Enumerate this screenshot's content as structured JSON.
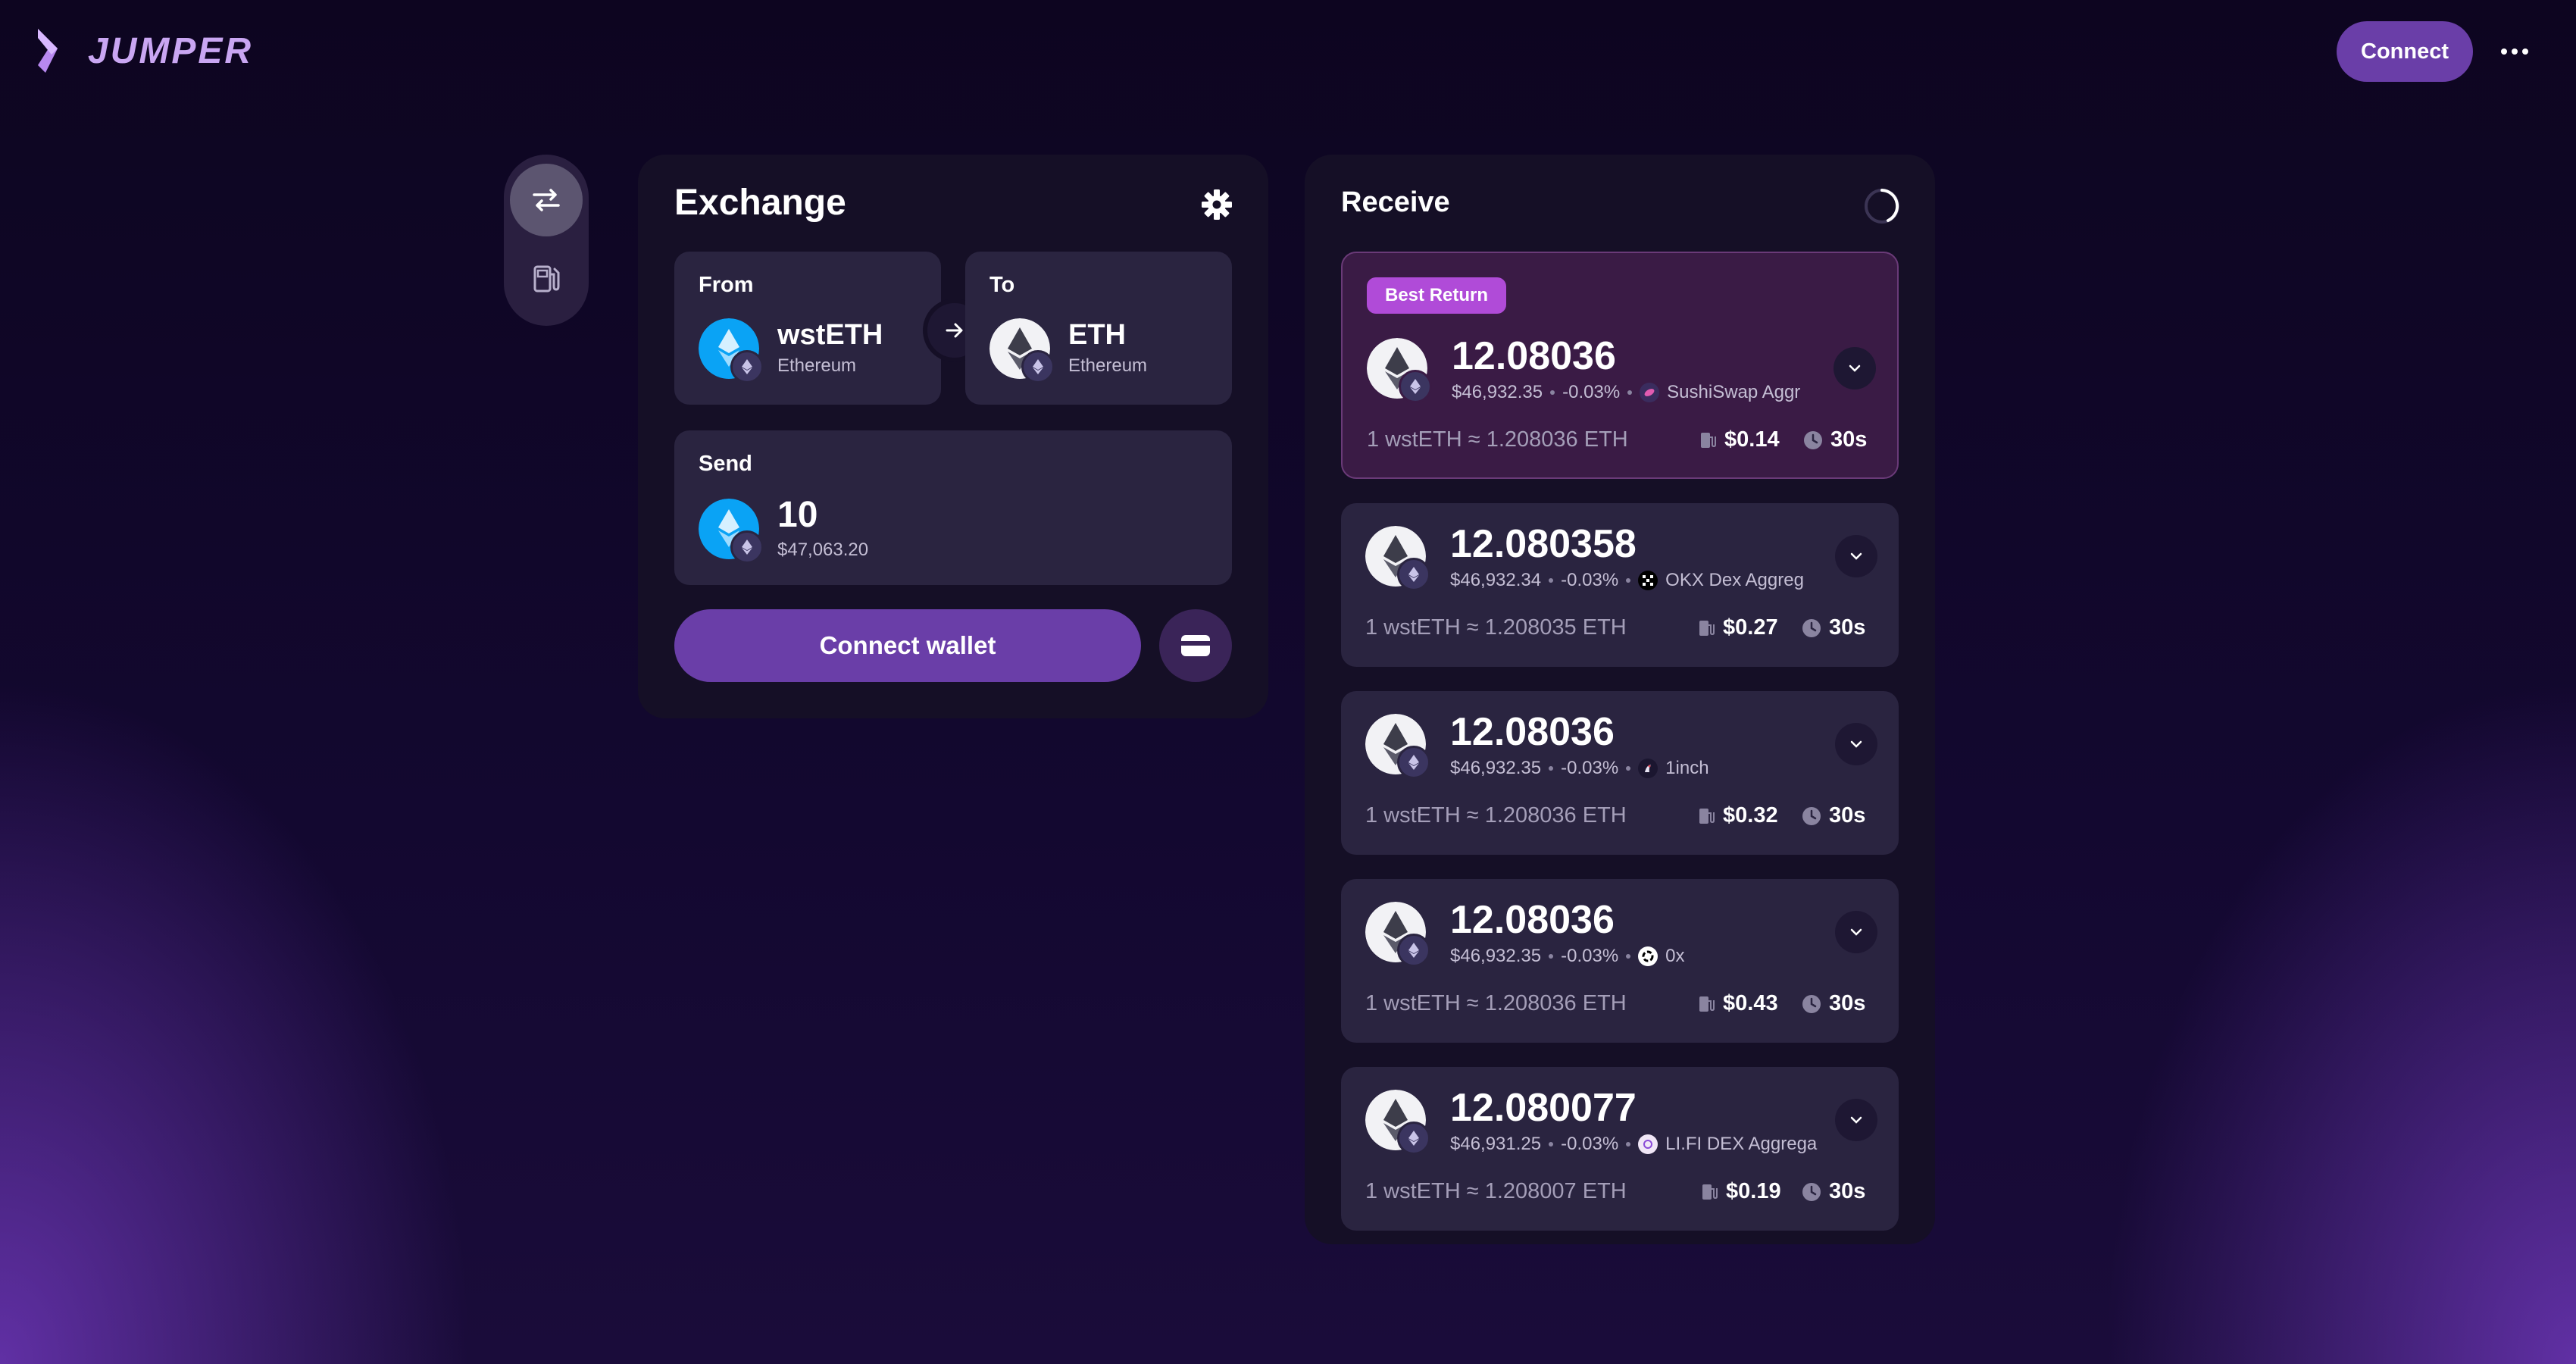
{
  "header": {
    "brand": "JUMPER",
    "connect_label": "Connect"
  },
  "exchange": {
    "title": "Exchange",
    "from": {
      "label": "From",
      "token": "wstETH",
      "chain": "Ethereum"
    },
    "to": {
      "label": "To",
      "token": "ETH",
      "chain": "Ethereum"
    },
    "send": {
      "label": "Send",
      "amount": "10",
      "usd": "$47,063.20"
    },
    "connect_wallet_label": "Connect wallet"
  },
  "receive": {
    "title": "Receive",
    "best_badge": "Best Return",
    "routes": [
      {
        "amount": "12.08036",
        "usd": "$46,932.35",
        "change": "-0.03%",
        "provider": "SushiSwap Aggr",
        "rate": "1 wstETH ≈ 1.208036 ETH",
        "gas": "$0.14",
        "time": "30s"
      },
      {
        "amount": "12.080358",
        "usd": "$46,932.34",
        "change": "-0.03%",
        "provider": "OKX Dex Aggreg",
        "rate": "1 wstETH ≈ 1.208035 ETH",
        "gas": "$0.27",
        "time": "30s"
      },
      {
        "amount": "12.08036",
        "usd": "$46,932.35",
        "change": "-0.03%",
        "provider": "1inch",
        "rate": "1 wstETH ≈ 1.208036 ETH",
        "gas": "$0.32",
        "time": "30s"
      },
      {
        "amount": "12.08036",
        "usd": "$46,932.35",
        "change": "-0.03%",
        "provider": "0x",
        "rate": "1 wstETH ≈ 1.208036 ETH",
        "gas": "$0.43",
        "time": "30s"
      },
      {
        "amount": "12.080077",
        "usd": "$46,931.25",
        "change": "-0.03%",
        "provider": "LI.FI DEX Aggrega",
        "rate": "1 wstETH ≈ 1.208007 ETH",
        "gas": "$0.19",
        "time": "30s"
      }
    ]
  },
  "colors": {
    "accent": "#6a3ea8",
    "badge": "#b04bd8",
    "panel": "#150f26",
    "card": "#2a2440"
  },
  "icons": [
    "jumper-logo-icon",
    "swap-icon",
    "gas-pump-icon",
    "gear-icon",
    "arrow-right-icon",
    "wallet-icon",
    "chevron-down-icon",
    "clock-icon",
    "spinner-icon",
    "more-icon"
  ]
}
